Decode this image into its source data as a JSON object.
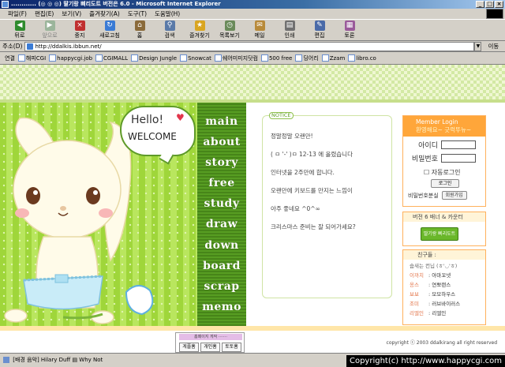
{
  "window": {
    "title": "............ (◎ ◎ ◎) 딸기랑 삐리도트 버전은 6.0 - Microsoft Internet Explorer"
  },
  "menu": [
    "파일(F)",
    "편집(E)",
    "보기(V)",
    "즐겨찾기(A)",
    "도구(T)",
    "도움말(H)"
  ],
  "toolbar": {
    "back": "뒤로",
    "forward": "앞으로",
    "stop": "중지",
    "refresh": "새로고침",
    "home": "홈",
    "search": "검색",
    "favorites": "즐겨찾기",
    "history": "목록보기",
    "mail": "메일",
    "print": "인쇄",
    "edit": "편집",
    "discuss": "토론"
  },
  "address": {
    "label": "주소(D)",
    "url": "http://ddalkis.ibbun.net/",
    "go": "이동"
  },
  "links": {
    "label": "연결",
    "items": [
      "해피CGI",
      "happycgi.job",
      "CGIMALL",
      "Design Jungle",
      "Snowcat",
      "쉐어미미지닷컴",
      "500 free",
      "딩어리",
      "Zzam",
      "libro.co"
    ]
  },
  "hero": {
    "hello": "Hello!",
    "welcome": "WELCOME"
  },
  "nav": [
    "main",
    "about",
    "story",
    "free",
    "study",
    "draw",
    "down",
    "board",
    "scrap",
    "memo"
  ],
  "notice": {
    "tag": "NOTICE",
    "items": [
      "정말정말 오랜만!",
      "( ㅁ '-' )ㅁ 12-13 에 올렸습니다",
      "인터넷을 2주만에 합니다.",
      "오랜만에 키보드를 만지는 느낌이",
      "아주 좋네요 ^0^∞",
      "크리스마스 준비는 잘 되어가세요?"
    ]
  },
  "login": {
    "title": "Member Login",
    "subtitle": "환영해요~ 긋럭뚜뉴~",
    "id_label": "아이디",
    "pw_label": "비밀번호",
    "auto": "자동로그인",
    "login_btn": "로그인",
    "find_label": "비밀번호분실",
    "join_btn": "회원가입"
  },
  "banner": {
    "title": "버전 6 배너 & 카운터",
    "img_text": "딸기랑 삐리도트"
  },
  "friends": {
    "title": "친구들 :",
    "subtitle": "숩새는 컨닙 (ㅎ'◡'ㅎ)",
    "rows": [
      {
        "k": "이까치",
        "v": ": 아마꼬넷"
      },
      {
        "k": "옹스",
        "v": ": 연뽀랜스"
      },
      {
        "k": "보보",
        "v": ": 모모하우스"
      },
      {
        "k": "조미",
        "v": ": 러브바이러스"
      },
      {
        "k": "리엘인",
        "v": ": 리엘인"
      }
    ]
  },
  "footer": {
    "copyright": "copyright ⓒ 2003 ddalkirang all right reserved",
    "hp_title": "홈페이지 게작 ·······",
    "hp_btns": [
      "게플홈",
      "개인홈",
      "토토홈"
    ]
  },
  "status": {
    "text": "[배경 음악] Hilary Duff ▤ Why Not"
  },
  "watermark": "Copyright(c) http://www.happycgi.com"
}
